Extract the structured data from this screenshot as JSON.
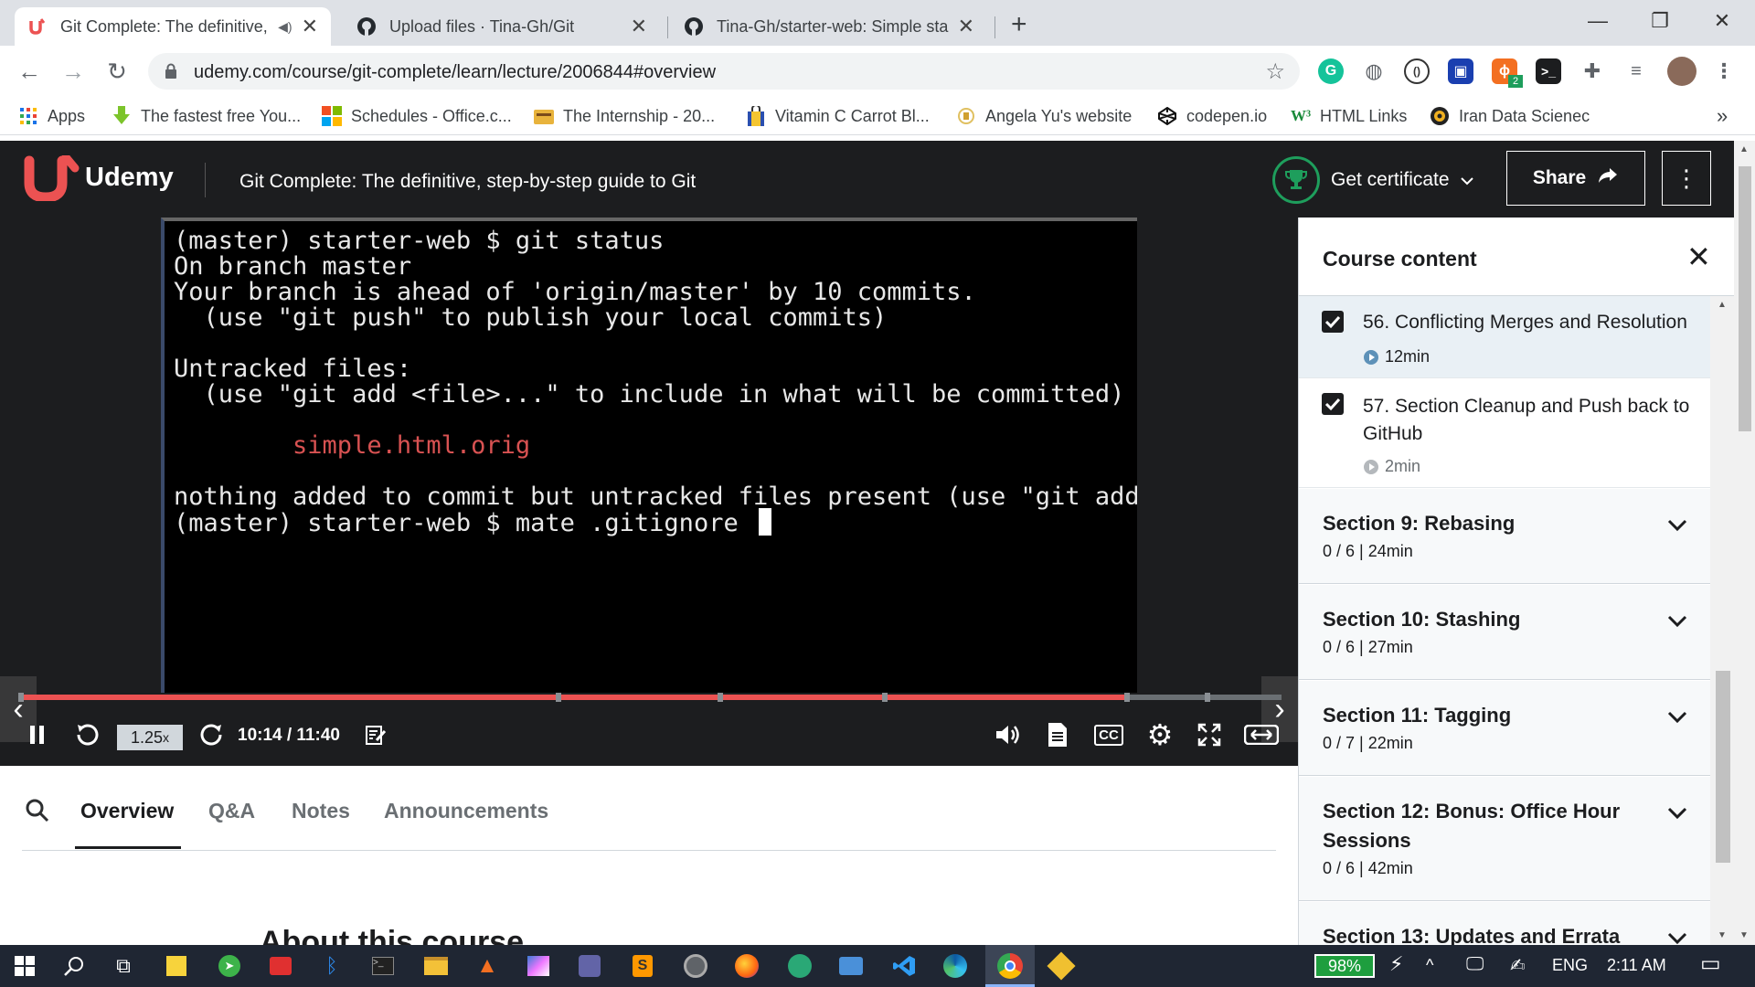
{
  "browser": {
    "tabs": [
      {
        "title": "Git Complete: The definitive, step-by-step guide to Git",
        "active": true
      },
      {
        "title": "Upload files · Tina-Gh/Git",
        "active": false
      },
      {
        "title": "Tina-Gh/starter-web: Simple starter web project",
        "active": false
      }
    ],
    "new_tab_symbol": "+",
    "url": "udemy.com/course/git-complete/learn/lecture/2006844#overview",
    "bookmarks": [
      {
        "label": "Apps",
        "icon": "apps-grid-icon"
      },
      {
        "label": "The fastest free You...",
        "icon": "download-arrow-icon"
      },
      {
        "label": "Schedules - Office.c...",
        "icon": "office-icon"
      },
      {
        "label": "The Internship - 20...",
        "icon": "folder-icon"
      },
      {
        "label": "Vitamin C Carrot Bl...",
        "icon": "shopping-bag-icon"
      },
      {
        "label": "Angela Yu's website",
        "icon": "site-icon"
      },
      {
        "label": "codepen.io",
        "icon": "codepen-icon"
      },
      {
        "label": "HTML Links",
        "icon": "w3-icon"
      },
      {
        "label": "Iran Data Scienec",
        "icon": "gear-logo-icon"
      }
    ],
    "bookmarks_overflow": "»",
    "extension_badge": "2"
  },
  "udemy": {
    "logo_text": "Udemy",
    "course_title": "Git Complete: The definitive, step-by-step guide to Git",
    "certificate_label": "Get certificate",
    "share_label": "Share"
  },
  "video": {
    "terminal_lines": [
      "(master) starter-web $ git status",
      "On branch master",
      "Your branch is ahead of 'origin/master' by 10 commits.",
      "  (use \"git push\" to publish your local commits)",
      "",
      "Untracked files:",
      "  (use \"git add <file>...\" to include in what will be committed)",
      "",
      "        simple.html.orig",
      "",
      "nothing added to commit but untracked files present (use \"git add\" to t",
      "(master) starter-web $ mate .gitignore "
    ],
    "progress_fraction": 0.88,
    "speed_label": "1.25",
    "speed_suffix": "x",
    "time_label": "10:14 / 11:40",
    "cc_label": "CC"
  },
  "lower_tabs": {
    "items": [
      "Overview",
      "Q&A",
      "Notes",
      "Announcements"
    ],
    "active_index": 0,
    "about_heading": "About this course"
  },
  "sidebar": {
    "title": "Course content",
    "lectures": [
      {
        "title": "56. Conflicting Merges and Resolution",
        "duration": "12min",
        "checked": true,
        "current": true
      },
      {
        "title": "57. Section Cleanup and Push back to GitHub",
        "duration": "2min",
        "checked": true,
        "current": false
      }
    ],
    "sections": [
      {
        "title": "Section 9: Rebasing",
        "meta": "0 / 6 | 24min"
      },
      {
        "title": "Section 10: Stashing",
        "meta": "0 / 6 | 27min"
      },
      {
        "title": "Section 11: Tagging",
        "meta": "0 / 7 | 22min"
      },
      {
        "title": "Section 12: Bonus: Office Hour Sessions",
        "meta": "0 / 6 | 42min"
      },
      {
        "title": "Section 13: Updates and Errata",
        "meta": ""
      }
    ]
  },
  "taskbar": {
    "battery": "98%",
    "language": "ENG",
    "clock": "2:11 AM"
  },
  "colors": {
    "udemy_dark": "#1c1d1f",
    "udemy_red": "#ec5252",
    "cert_green": "#1e9e5c",
    "current_lecture_bg": "#e9f0f5"
  }
}
